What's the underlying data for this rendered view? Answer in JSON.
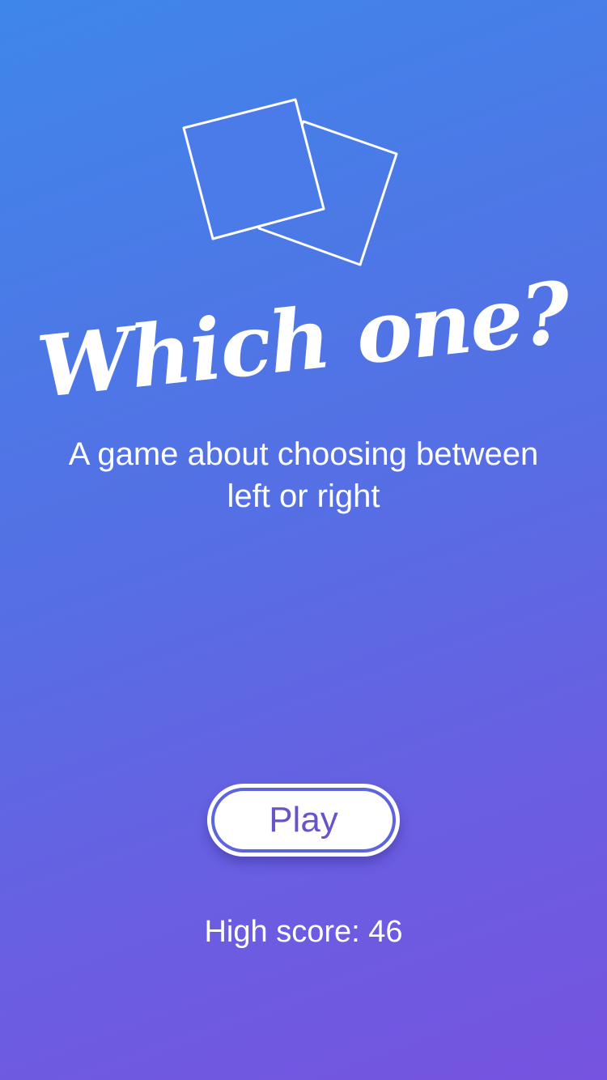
{
  "app": {
    "logo_icon": "two-overlapping-cards-icon",
    "title": "Which one?",
    "subtitle": "A game about choosing between left or right"
  },
  "play_button": {
    "label": "Play"
  },
  "stats": {
    "high_score_text": "High score: 46"
  },
  "colors": {
    "gradient_start": "#3F86EA",
    "gradient_end": "#7653E0",
    "button_text": "#6A52C9",
    "foreground": "#ffffff"
  }
}
